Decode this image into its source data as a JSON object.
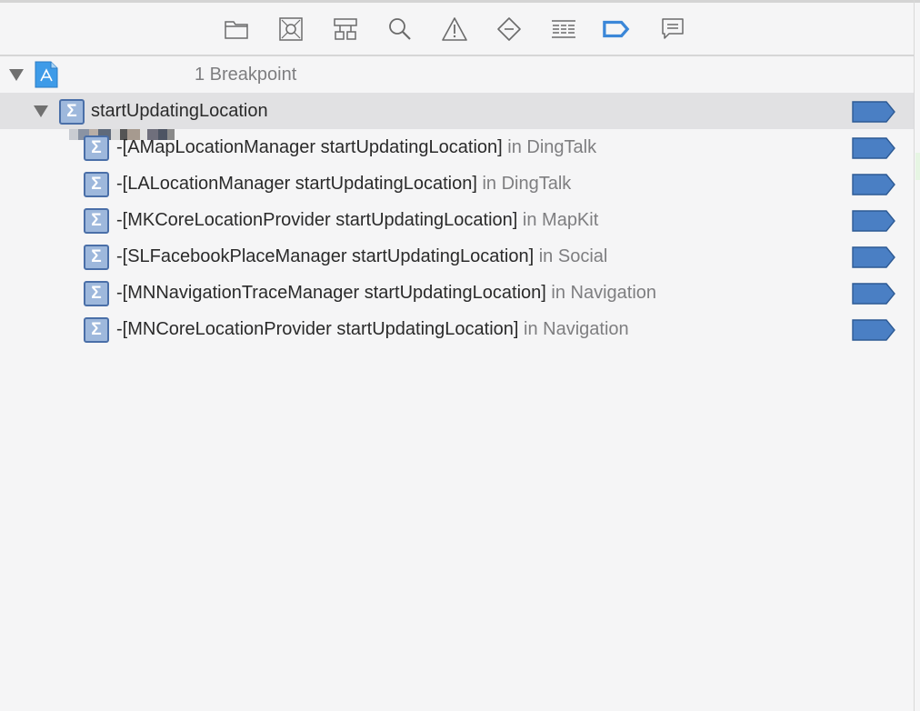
{
  "toolbar": {
    "icons": [
      "folder-icon",
      "source-control-icon",
      "hierarchy-icon",
      "search-icon",
      "warning-icon",
      "test-diamond-icon",
      "debug-list-icon",
      "breakpoint-icon",
      "report-icon"
    ],
    "active": "breakpoint-icon",
    "active_color": "#3b87d8"
  },
  "project": {
    "count_label": "1 Breakpoint"
  },
  "group": {
    "label": "startUpdatingLocation"
  },
  "breakpoints": [
    {
      "symbol": "-[AMapLocationManager startUpdatingLocation]",
      "module": "in DingTalk"
    },
    {
      "symbol": "-[LALocationManager startUpdatingLocation]",
      "module": "in DingTalk"
    },
    {
      "symbol": "-[MKCoreLocationProvider startUpdatingLocation]",
      "module": "in MapKit"
    },
    {
      "symbol": "-[SLFacebookPlaceManager startUpdatingLocation]",
      "module": "in Social"
    },
    {
      "symbol": "-[MNNavigationTraceManager startUpdatingLocation]",
      "module": "in Navigation"
    },
    {
      "symbol": "-[MNCoreLocationProvider startUpdatingLocation]",
      "module": "in Navigation"
    }
  ],
  "colors": {
    "breakpoint_fill": "#4a7fc4",
    "breakpoint_stroke": "#2d5a94",
    "selected_row": "#e1e1e3"
  }
}
